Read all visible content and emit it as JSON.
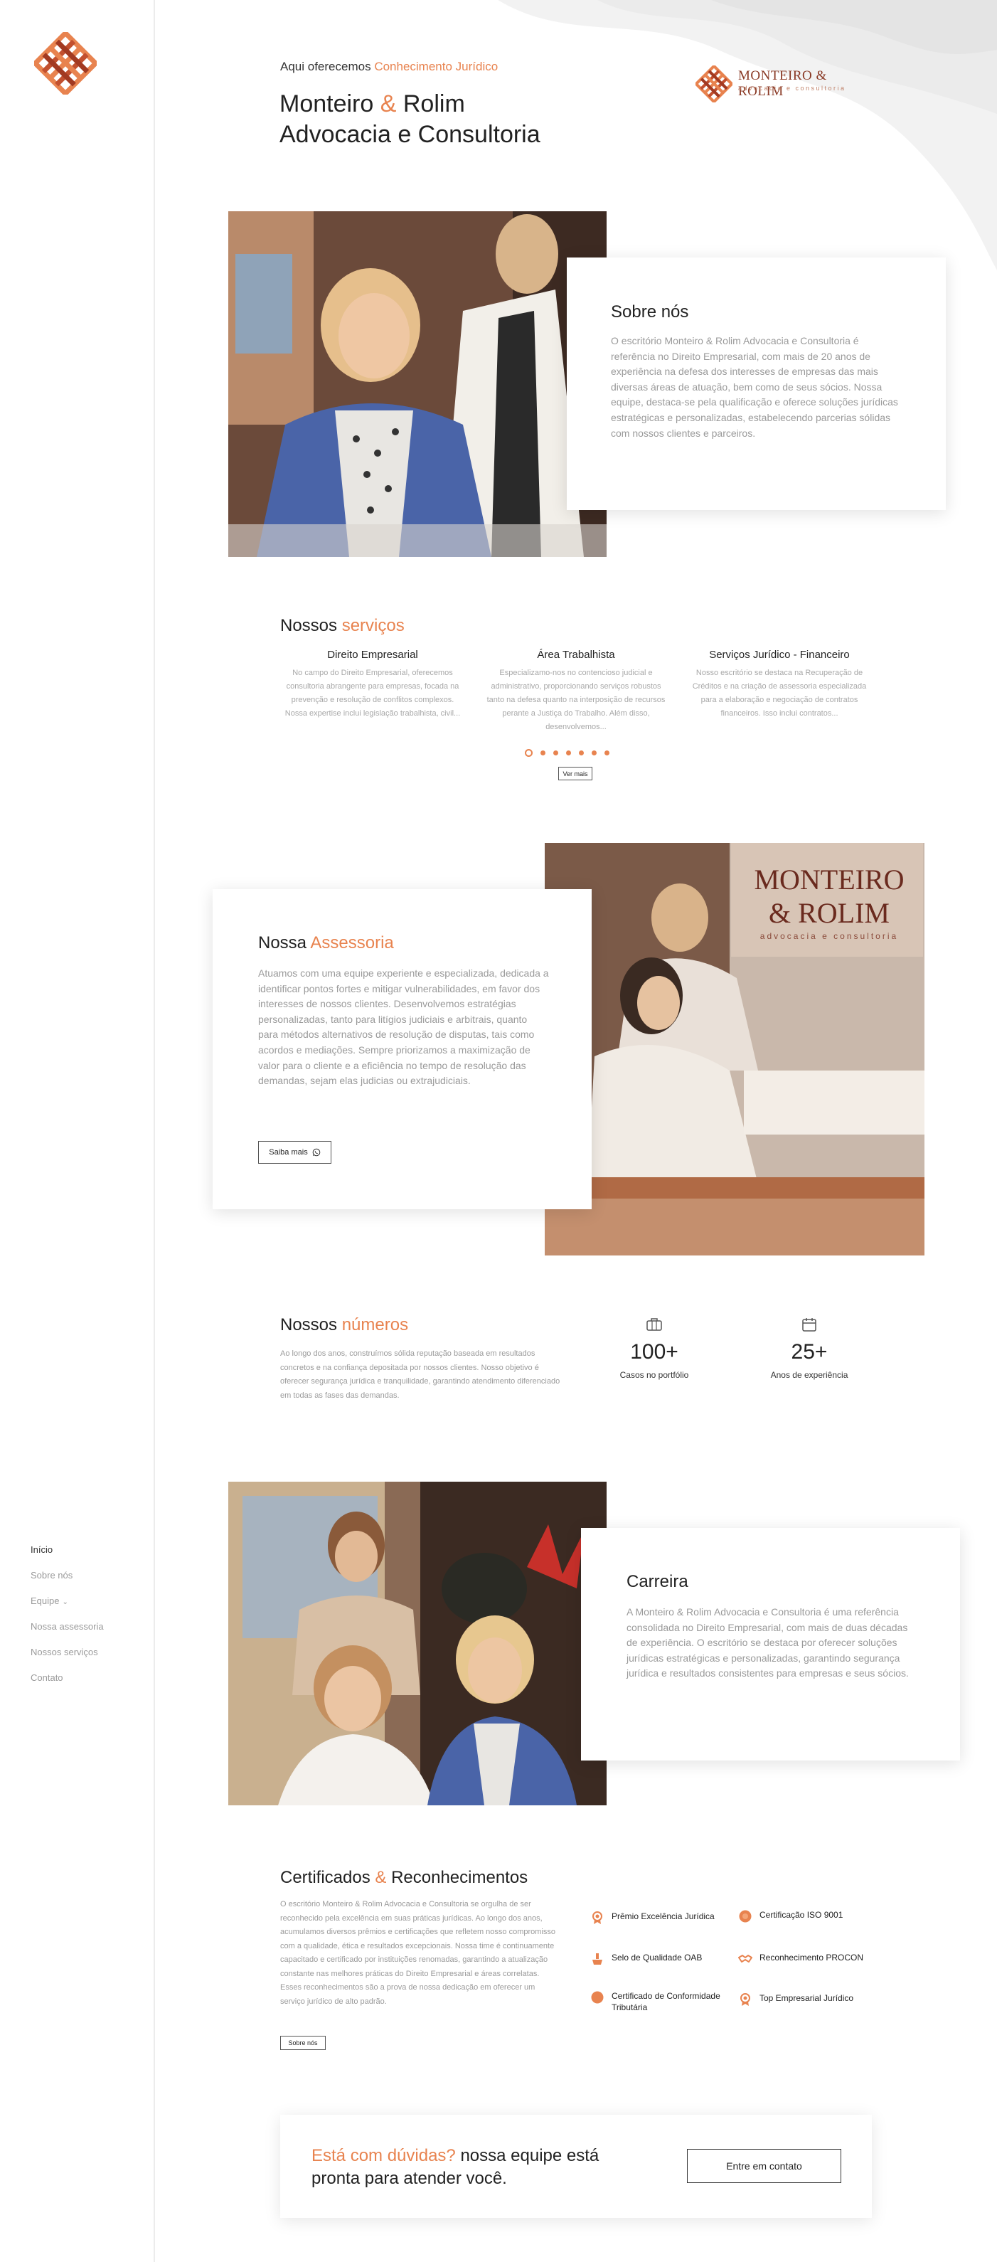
{
  "nav": {
    "items": [
      "Início",
      "Sobre nós",
      "Equipe",
      "Nossa assessoria",
      "Nossos serviços",
      "Contato"
    ]
  },
  "hero": {
    "intro_prefix": "Aqui oferecemos",
    "intro_accent": "Conhecimento Jurídico",
    "title_part1": "Monteiro",
    "title_amp": "&",
    "title_part2": "Rolim",
    "title_line2": "Advocacia e Consultoria"
  },
  "brand": {
    "name": "MONTEIRO & ROLIM",
    "tagline": "advocacia e consultoria"
  },
  "about": {
    "title": "Sobre nós",
    "text": "O escritório Monteiro & Rolim Advocacia e Consultoria é referência no Direito Empresarial, com mais de 20 anos de experiência na defesa dos interesses de empresas das mais diversas áreas de atuação, bem como de seus sócios. Nossa equipe, destaca-se pela qualificação e oferece soluções jurídicas estratégicas e personalizadas, estabelecendo parcerias sólidas com nossos clientes e parceiros."
  },
  "services": {
    "title_prefix": "Nossos",
    "title_accent": "serviços",
    "items": [
      {
        "title": "Direito Empresarial",
        "text": "No campo do Direito Empresarial, oferecemos consultoria abrangente para empresas, focada na prevenção e resolução de conflitos complexos. Nossa expertise inclui legislação trabalhista, civil..."
      },
      {
        "title": "Área Trabalhista",
        "text": "Especializamo-nos no contencioso judicial e administrativo, proporcionando serviços robustos tanto na defesa quanto na interposição de recursos perante a Justiça do Trabalho. Além disso, desenvolvemos..."
      },
      {
        "title": "Serviços Jurídico - Financeiro",
        "text": "Nosso escritório se destaca na Recuperação de Créditos e na criação de assessoria especializada para a elaboração e negociação de contratos financeiros. Isso inclui contratos..."
      }
    ],
    "button": "Ver mais"
  },
  "advisory": {
    "title_prefix": "Nossa",
    "title_accent": "Assessoria",
    "text": "Atuamos com uma equipe experiente e especializada, dedicada a identificar pontos fortes e mitigar vulnerabilidades, em favor dos interesses de nossos clientes. Desenvolvemos estratégias personalizadas, tanto para litígios judiciais e arbitrais, quanto para métodos alternativos de resolução de disputas, tais como acordos e mediações. Sempre priorizamos a maximização de valor para o cliente e a eficiência no tempo de resolução das demandas, sejam elas judicias ou extrajudiciais.",
    "button": "Saiba mais",
    "sign_line1": "MONTEIRO",
    "sign_line2": "& ROLIM",
    "sign_sub": "advocacia e consultoria"
  },
  "numbers": {
    "title_prefix": "Nossos",
    "title_accent": "números",
    "text": "Ao longo dos anos, construímos sólida reputação baseada em resultados concretos e na confiança depositada por nossos clientes. Nosso objetivo é oferecer segurança jurídica e tranquilidade, garantindo atendimento diferenciado em todas as fases das demandas.",
    "stats": [
      {
        "icon": "briefcase-icon",
        "value": "100+",
        "label": "Casos no portfólio"
      },
      {
        "icon": "calendar-icon",
        "value": "25+",
        "label": "Anos de experiência"
      }
    ]
  },
  "career": {
    "title": "Carreira",
    "text": "A Monteiro & Rolim Advocacia e Consultoria é uma referência consolidada no Direito Empresarial, com mais de duas décadas de experiência. O escritório se destaca por oferecer soluções jurídicas estratégicas e personalizadas, garantindo segurança jurídica e resultados consistentes para empresas e seus sócios."
  },
  "certificates": {
    "title_prefix": "Certificados",
    "title_amp": "&",
    "title_suffix": "Reconhecimentos",
    "text": "O escritório Monteiro & Rolim Advocacia e Consultoria se orgulha de ser reconhecido pela excelência em suas práticas jurídicas. Ao longo dos anos, acumulamos diversos prêmios e certificações que refletem nosso compromisso com a qualidade, ética e resultados excepcionais. Nossa time é continuamente capacitado e certificado por instituições renomadas, garantindo a atualização constante nas melhores práticas do Direito Empresarial e áreas correlatas. Esses reconhecimentos são a prova de nossa dedicação em oferecer um serviço jurídico de alto padrão.",
    "button": "Sobre nós",
    "items": [
      {
        "icon": "award-icon",
        "label": "Prêmio Excelência Jurídica"
      },
      {
        "icon": "badge-icon",
        "label": "Certificação ISO 9001"
      },
      {
        "icon": "quality-seal-icon",
        "label": "Selo de Qualidade OAB"
      },
      {
        "icon": "handshake-icon",
        "label": "Reconhecimento PROCON"
      },
      {
        "icon": "certificate-icon",
        "label": "Certificado de Conformidade Tributária"
      },
      {
        "icon": "medal-icon",
        "label": "Top Empresarial Jurídico"
      }
    ]
  },
  "cta": {
    "accent": "Está com dúvidas?",
    "text": "nossa equipe está pronta para atender você.",
    "button": "Entre em contato"
  },
  "colors": {
    "accent": "#e8834f",
    "logo_dark": "#b5452a",
    "text": "#222222",
    "muted": "#9a9a9a"
  }
}
